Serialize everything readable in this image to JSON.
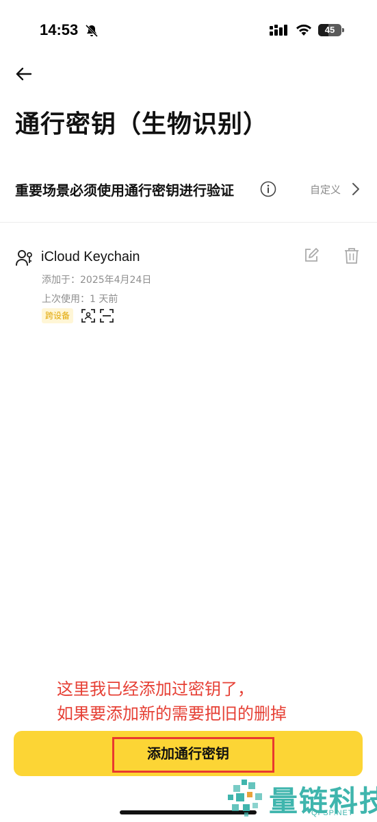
{
  "status_bar": {
    "time": "14:53",
    "battery_level": "45",
    "battery_fraction": 0.45
  },
  "header": {
    "back_icon": "arrow-left-icon",
    "title": "通行密钥（生物识别）"
  },
  "setting": {
    "label": "重要场景必须使用通行密钥进行验证",
    "value": "自定义"
  },
  "passkey": {
    "name": "iCloud Keychain",
    "added": "添加于：2025年4月24日",
    "last_used": "上次使用：1 天前",
    "tag": "跨设备",
    "icons": [
      "user-key-icon",
      "edit-icon",
      "trash-icon",
      "face-id-icon",
      "scan-icon"
    ]
  },
  "annotation": {
    "line1": "这里我已经添加过密钥了，",
    "line2": "如果要添加新的需要把旧的删掉"
  },
  "primary_button": {
    "label": "添加通行密钥"
  },
  "watermark": {
    "text": "量链科技",
    "sub": "QFSP.NET"
  },
  "colors": {
    "accent": "#fcd535",
    "annotation": "#e64035",
    "tag_text": "#e0a500",
    "tag_bg": "#fff6d6",
    "watermark": "#3fb5ad"
  }
}
